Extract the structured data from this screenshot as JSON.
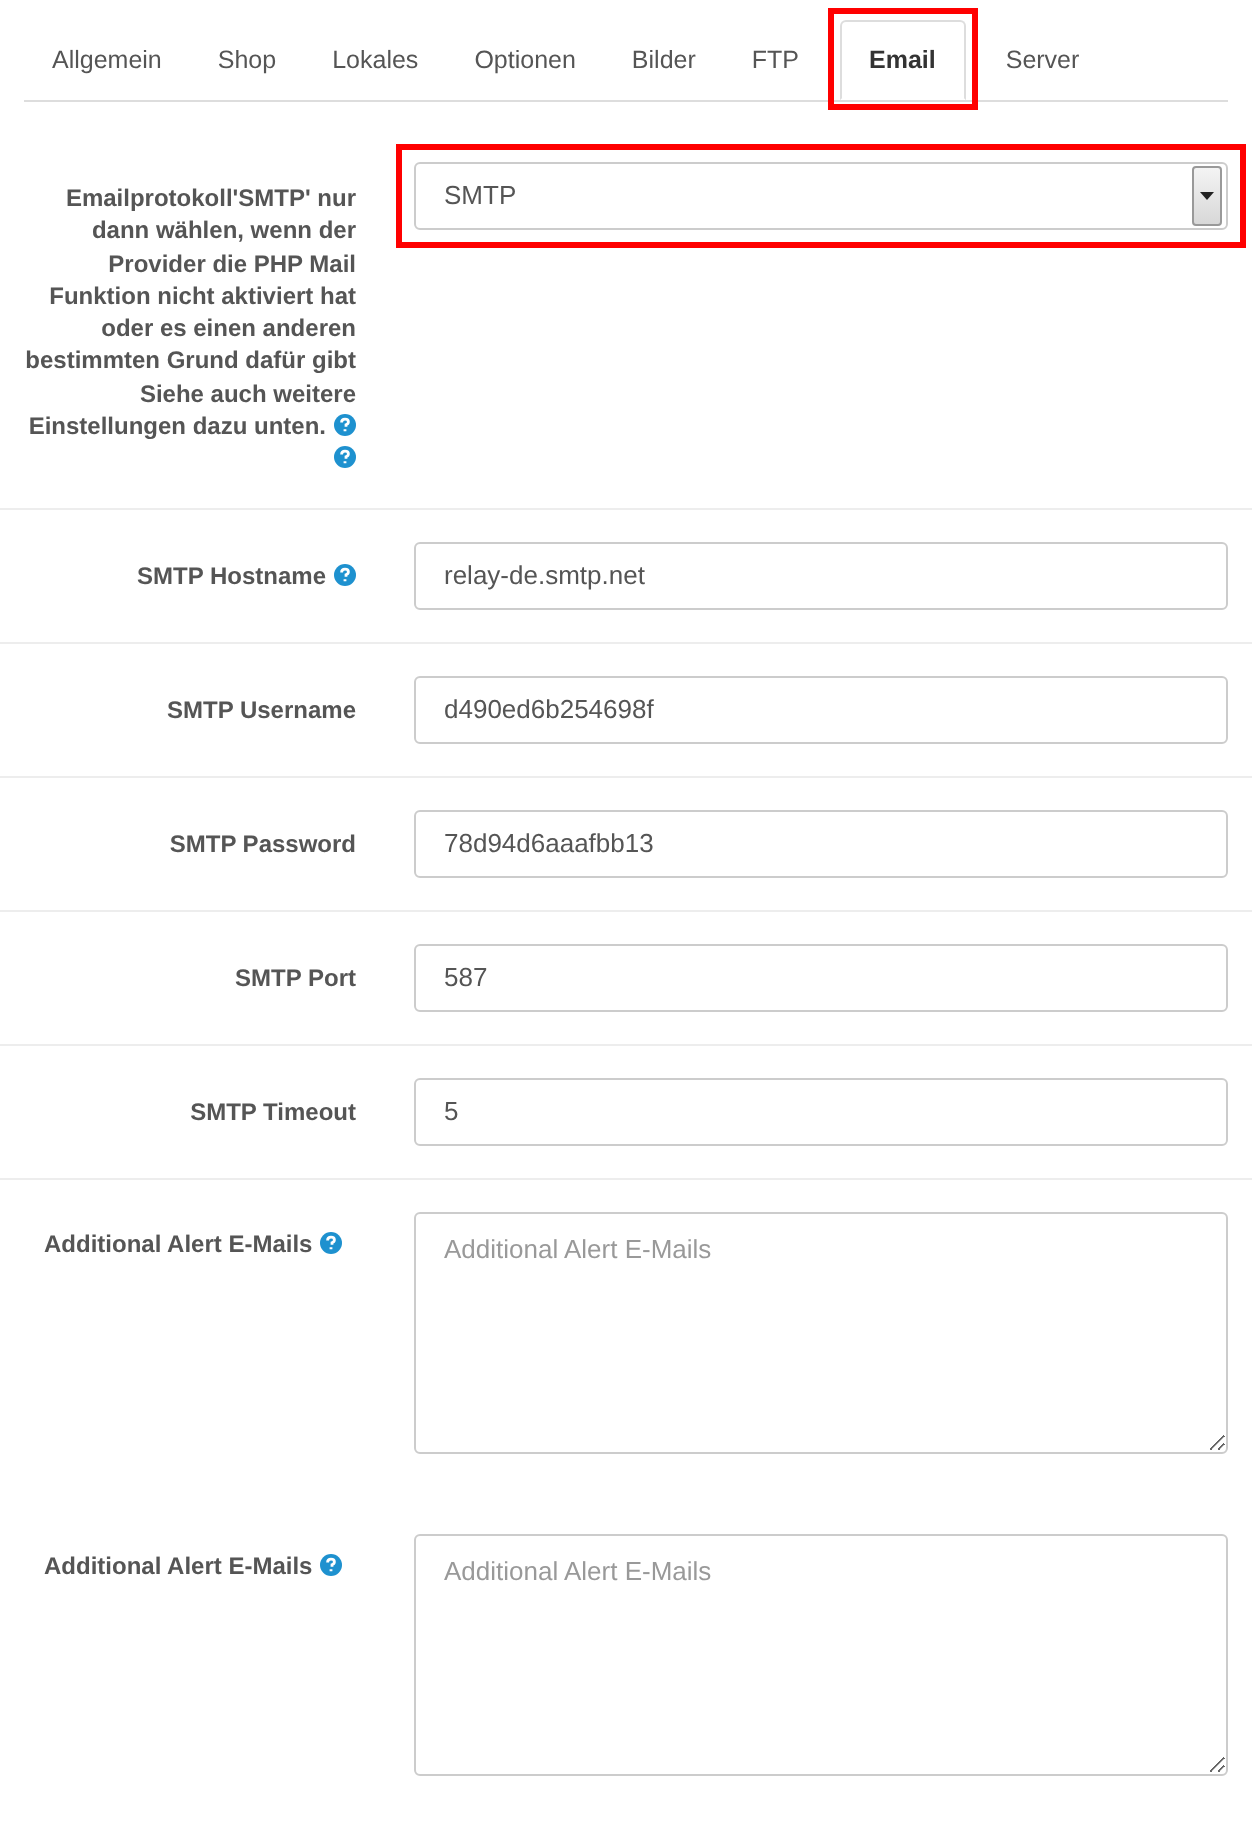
{
  "tabs": [
    {
      "label": "Allgemein",
      "selected": false,
      "highlighted": false
    },
    {
      "label": "Shop",
      "selected": false,
      "highlighted": false
    },
    {
      "label": "Lokales",
      "selected": false,
      "highlighted": false
    },
    {
      "label": "Optionen",
      "selected": false,
      "highlighted": false
    },
    {
      "label": "Bilder",
      "selected": false,
      "highlighted": false
    },
    {
      "label": "FTP",
      "selected": false,
      "highlighted": false
    },
    {
      "label": "Email",
      "selected": true,
      "highlighted": true
    },
    {
      "label": "Server",
      "selected": false,
      "highlighted": false
    }
  ],
  "fields": [
    {
      "kind": "select",
      "label": [
        "Emailprotokoll'SMTP' nur dann wählen, wenn der Provider die PHP Mail Funktion nicht aktiviert hat oder es einen anderen bestimmten Grund dafür gibt",
        "Siehe auch weitere Einstellungen dazu unten."
      ],
      "help_icons": [
        {
          "kind": "help"
        },
        {
          "kind": "help"
        }
      ],
      "value": "SMTP",
      "highlighted": true
    },
    {
      "kind": "input",
      "label": [
        "SMTP Hostname"
      ],
      "help_icons": [
        {
          "kind": "help"
        }
      ],
      "value": "relay-de.smtp.net"
    },
    {
      "kind": "input",
      "label": [
        "SMTP Username"
      ],
      "value": "d490ed6b254698f"
    },
    {
      "kind": "input",
      "label": [
        "SMTP Password"
      ],
      "value": "78d94d6aaafbb13"
    },
    {
      "kind": "input",
      "label": [
        "SMTP Port"
      ],
      "value": "587"
    },
    {
      "kind": "input",
      "label": [
        "SMTP Timeout"
      ],
      "value": "5"
    },
    {
      "kind": "textarea",
      "label": [
        "Additional Alert E-Mails"
      ],
      "help_icons": [
        {
          "kind": "help"
        }
      ],
      "placeholder": "Additional Alert E-Mails"
    },
    {
      "kind": "textarea",
      "label": [
        "Additional Alert E-Mails"
      ],
      "help_icons": [
        {
          "kind": "help"
        }
      ],
      "placeholder": "Additional Alert E-Mails"
    }
  ]
}
